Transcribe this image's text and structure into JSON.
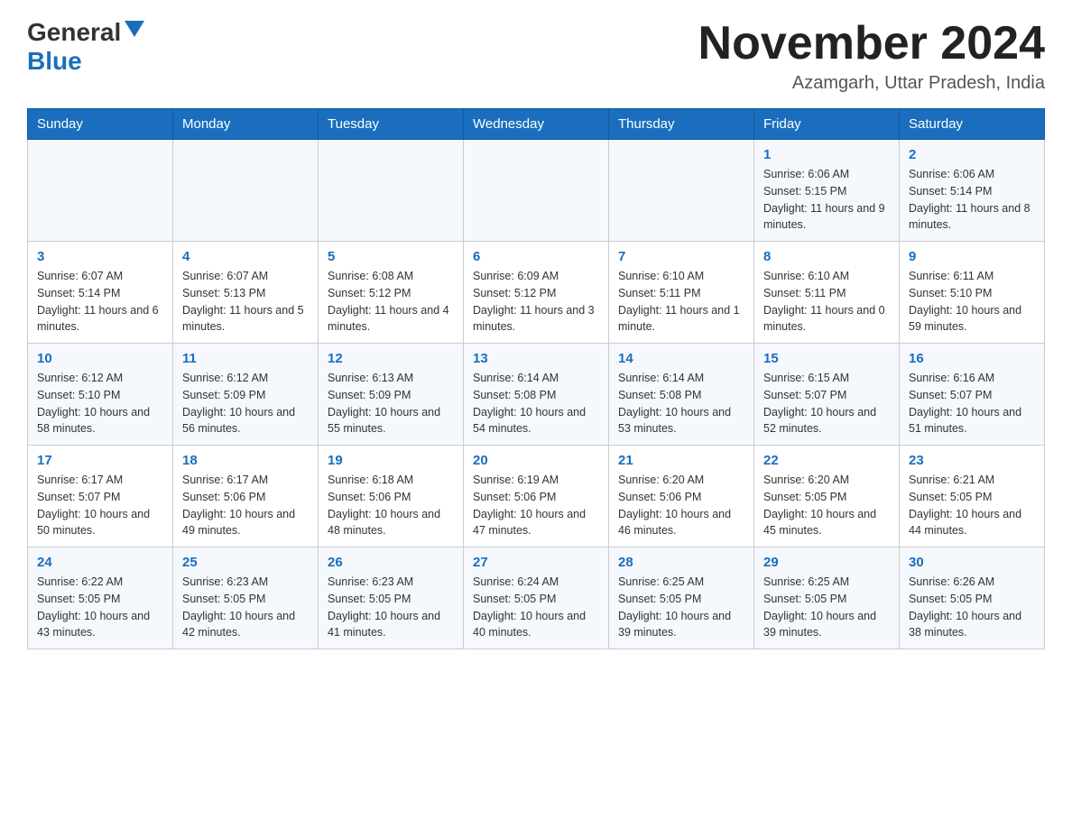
{
  "header": {
    "logo_general": "General",
    "logo_blue": "Blue",
    "month_title": "November 2024",
    "location": "Azamgarh, Uttar Pradesh, India"
  },
  "days_of_week": [
    "Sunday",
    "Monday",
    "Tuesday",
    "Wednesday",
    "Thursday",
    "Friday",
    "Saturday"
  ],
  "weeks": [
    [
      {
        "day": "",
        "info": ""
      },
      {
        "day": "",
        "info": ""
      },
      {
        "day": "",
        "info": ""
      },
      {
        "day": "",
        "info": ""
      },
      {
        "day": "",
        "info": ""
      },
      {
        "day": "1",
        "info": "Sunrise: 6:06 AM\nSunset: 5:15 PM\nDaylight: 11 hours and 9 minutes."
      },
      {
        "day": "2",
        "info": "Sunrise: 6:06 AM\nSunset: 5:14 PM\nDaylight: 11 hours and 8 minutes."
      }
    ],
    [
      {
        "day": "3",
        "info": "Sunrise: 6:07 AM\nSunset: 5:14 PM\nDaylight: 11 hours and 6 minutes."
      },
      {
        "day": "4",
        "info": "Sunrise: 6:07 AM\nSunset: 5:13 PM\nDaylight: 11 hours and 5 minutes."
      },
      {
        "day": "5",
        "info": "Sunrise: 6:08 AM\nSunset: 5:12 PM\nDaylight: 11 hours and 4 minutes."
      },
      {
        "day": "6",
        "info": "Sunrise: 6:09 AM\nSunset: 5:12 PM\nDaylight: 11 hours and 3 minutes."
      },
      {
        "day": "7",
        "info": "Sunrise: 6:10 AM\nSunset: 5:11 PM\nDaylight: 11 hours and 1 minute."
      },
      {
        "day": "8",
        "info": "Sunrise: 6:10 AM\nSunset: 5:11 PM\nDaylight: 11 hours and 0 minutes."
      },
      {
        "day": "9",
        "info": "Sunrise: 6:11 AM\nSunset: 5:10 PM\nDaylight: 10 hours and 59 minutes."
      }
    ],
    [
      {
        "day": "10",
        "info": "Sunrise: 6:12 AM\nSunset: 5:10 PM\nDaylight: 10 hours and 58 minutes."
      },
      {
        "day": "11",
        "info": "Sunrise: 6:12 AM\nSunset: 5:09 PM\nDaylight: 10 hours and 56 minutes."
      },
      {
        "day": "12",
        "info": "Sunrise: 6:13 AM\nSunset: 5:09 PM\nDaylight: 10 hours and 55 minutes."
      },
      {
        "day": "13",
        "info": "Sunrise: 6:14 AM\nSunset: 5:08 PM\nDaylight: 10 hours and 54 minutes."
      },
      {
        "day": "14",
        "info": "Sunrise: 6:14 AM\nSunset: 5:08 PM\nDaylight: 10 hours and 53 minutes."
      },
      {
        "day": "15",
        "info": "Sunrise: 6:15 AM\nSunset: 5:07 PM\nDaylight: 10 hours and 52 minutes."
      },
      {
        "day": "16",
        "info": "Sunrise: 6:16 AM\nSunset: 5:07 PM\nDaylight: 10 hours and 51 minutes."
      }
    ],
    [
      {
        "day": "17",
        "info": "Sunrise: 6:17 AM\nSunset: 5:07 PM\nDaylight: 10 hours and 50 minutes."
      },
      {
        "day": "18",
        "info": "Sunrise: 6:17 AM\nSunset: 5:06 PM\nDaylight: 10 hours and 49 minutes."
      },
      {
        "day": "19",
        "info": "Sunrise: 6:18 AM\nSunset: 5:06 PM\nDaylight: 10 hours and 48 minutes."
      },
      {
        "day": "20",
        "info": "Sunrise: 6:19 AM\nSunset: 5:06 PM\nDaylight: 10 hours and 47 minutes."
      },
      {
        "day": "21",
        "info": "Sunrise: 6:20 AM\nSunset: 5:06 PM\nDaylight: 10 hours and 46 minutes."
      },
      {
        "day": "22",
        "info": "Sunrise: 6:20 AM\nSunset: 5:05 PM\nDaylight: 10 hours and 45 minutes."
      },
      {
        "day": "23",
        "info": "Sunrise: 6:21 AM\nSunset: 5:05 PM\nDaylight: 10 hours and 44 minutes."
      }
    ],
    [
      {
        "day": "24",
        "info": "Sunrise: 6:22 AM\nSunset: 5:05 PM\nDaylight: 10 hours and 43 minutes."
      },
      {
        "day": "25",
        "info": "Sunrise: 6:23 AM\nSunset: 5:05 PM\nDaylight: 10 hours and 42 minutes."
      },
      {
        "day": "26",
        "info": "Sunrise: 6:23 AM\nSunset: 5:05 PM\nDaylight: 10 hours and 41 minutes."
      },
      {
        "day": "27",
        "info": "Sunrise: 6:24 AM\nSunset: 5:05 PM\nDaylight: 10 hours and 40 minutes."
      },
      {
        "day": "28",
        "info": "Sunrise: 6:25 AM\nSunset: 5:05 PM\nDaylight: 10 hours and 39 minutes."
      },
      {
        "day": "29",
        "info": "Sunrise: 6:25 AM\nSunset: 5:05 PM\nDaylight: 10 hours and 39 minutes."
      },
      {
        "day": "30",
        "info": "Sunrise: 6:26 AM\nSunset: 5:05 PM\nDaylight: 10 hours and 38 minutes."
      }
    ]
  ]
}
